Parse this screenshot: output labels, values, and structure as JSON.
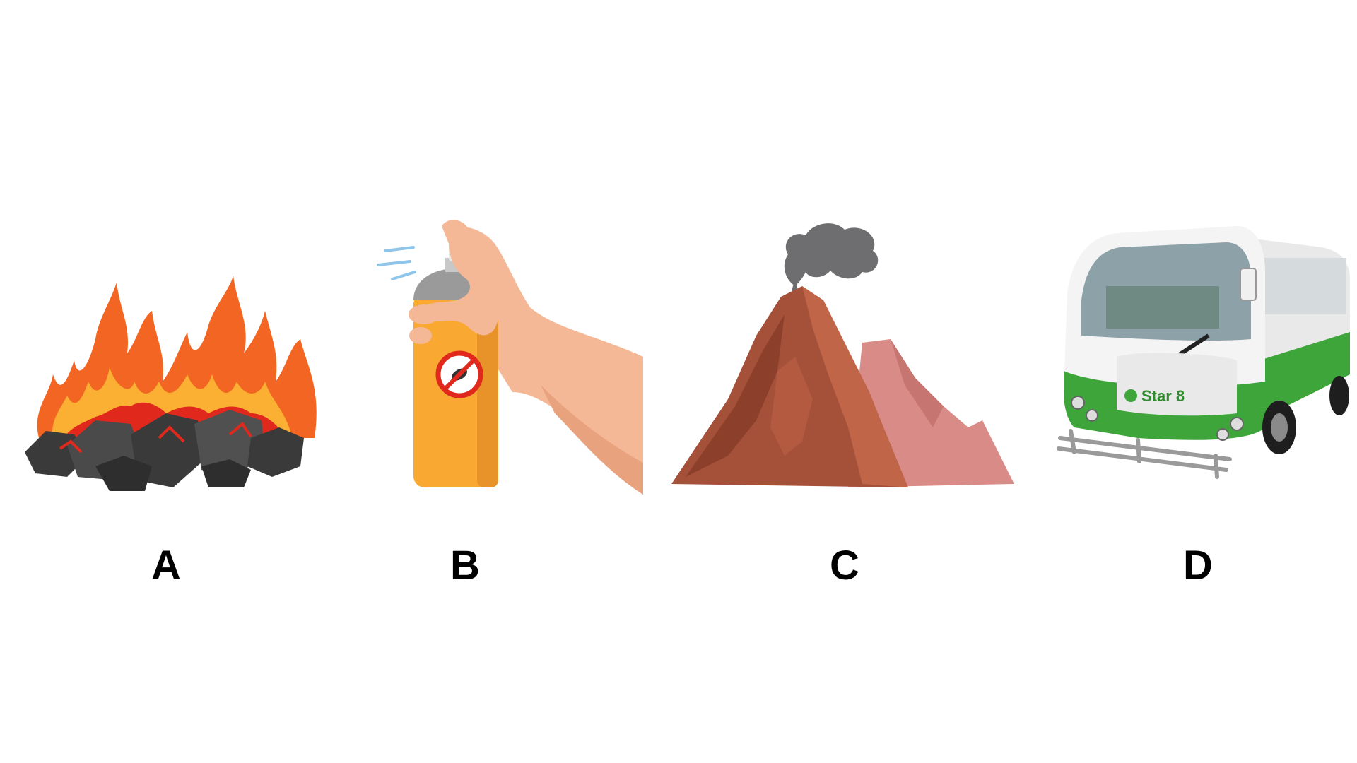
{
  "options": [
    {
      "letter": "A",
      "image": "burning-coal-fire"
    },
    {
      "letter": "B",
      "image": "insect-repellent-spray-can"
    },
    {
      "letter": "C",
      "image": "volcano-smoke"
    },
    {
      "letter": "D",
      "image": "green-electric-bus"
    }
  ],
  "bus_brand": "Star 8",
  "colors": {
    "fire_orange": "#f26522",
    "fire_yellow": "#fbb034",
    "coal_dark": "#3a3a3a",
    "can_orange": "#f9a832",
    "volcano_brown": "#a5513a",
    "volcano_pink": "#d98b88",
    "bus_green": "#3da53a"
  }
}
